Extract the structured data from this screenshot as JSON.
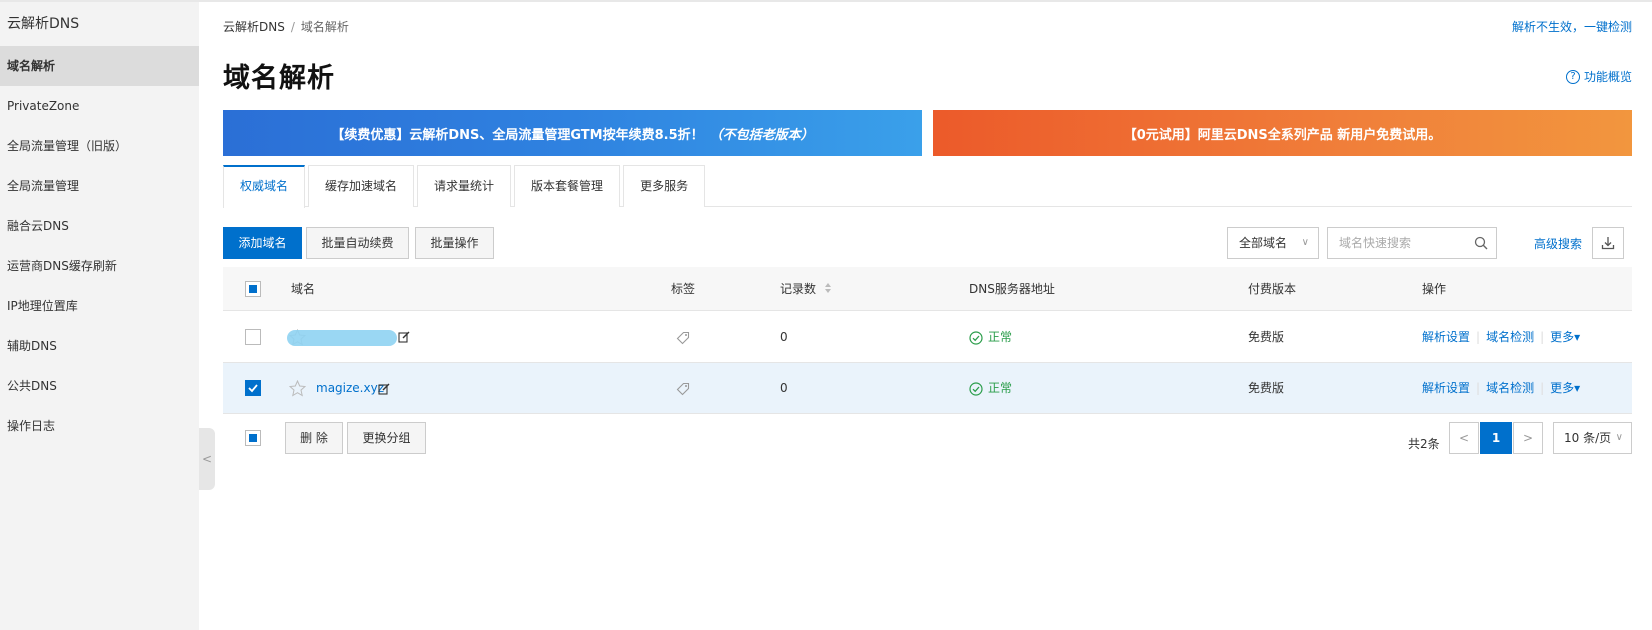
{
  "sidebar": {
    "title": "云解析DNS",
    "items": [
      {
        "label": "域名解析"
      },
      {
        "label": "PrivateZone"
      },
      {
        "label": "全局流量管理（旧版）"
      },
      {
        "label": "全局流量管理"
      },
      {
        "label": "融合云DNS"
      },
      {
        "label": "运营商DNS缓存刷新"
      },
      {
        "label": "IP地理位置库"
      },
      {
        "label": "辅助DNS"
      },
      {
        "label": "公共DNS"
      },
      {
        "label": "操作日志"
      }
    ],
    "collapse_glyph": "<"
  },
  "breadcrumb": {
    "root": "云解析DNS",
    "sep": "/",
    "current": "域名解析"
  },
  "top_link": "解析不生效，一键检测",
  "page_title": "域名解析",
  "overview": {
    "icon_text": "?",
    "label": "功能概览"
  },
  "banners": {
    "left": {
      "main": "【续费优惠】云解析DNS、全局流量管理GTM按年续费8.5折！",
      "note": "（不包括老版本）"
    },
    "right": "【0元试用】阿里云DNS全系列产品 新用户免费试用。"
  },
  "tabs": [
    "权威域名",
    "缓存加速域名",
    "请求量统计",
    "版本套餐管理",
    "更多服务"
  ],
  "toolbar": {
    "add": "添加域名",
    "auto_renew": "批量自动续费",
    "batch": "批量操作",
    "filter": "全部域名",
    "filter_chevron": "∨",
    "search_placeholder": "域名快速搜索",
    "advanced": "高级搜索"
  },
  "table": {
    "headers": {
      "domain": "域名",
      "tag": "标签",
      "records": "记录数",
      "dns": "DNS服务器地址",
      "version": "付费版本",
      "actions": "操作"
    },
    "rows": [
      {
        "domain": "",
        "records": "0",
        "status": "正常",
        "version": "免费版",
        "a1": "解析设置",
        "a2": "域名检测",
        "a3": "更多▾",
        "checked": false
      },
      {
        "domain": "magize.xyz",
        "records": "0",
        "status": "正常",
        "version": "免费版",
        "a1": "解析设置",
        "a2": "域名检测",
        "a3": "更多▾",
        "checked": true
      }
    ]
  },
  "footer": {
    "delete": "删 除",
    "change_group": "更换分组",
    "total": "共2条",
    "prev": "<",
    "page": "1",
    "next": ">",
    "page_size": "10 条/页",
    "page_size_chevron": "∨"
  },
  "colors": {
    "primary": "#0070cc",
    "success": "#2a9d4a"
  }
}
